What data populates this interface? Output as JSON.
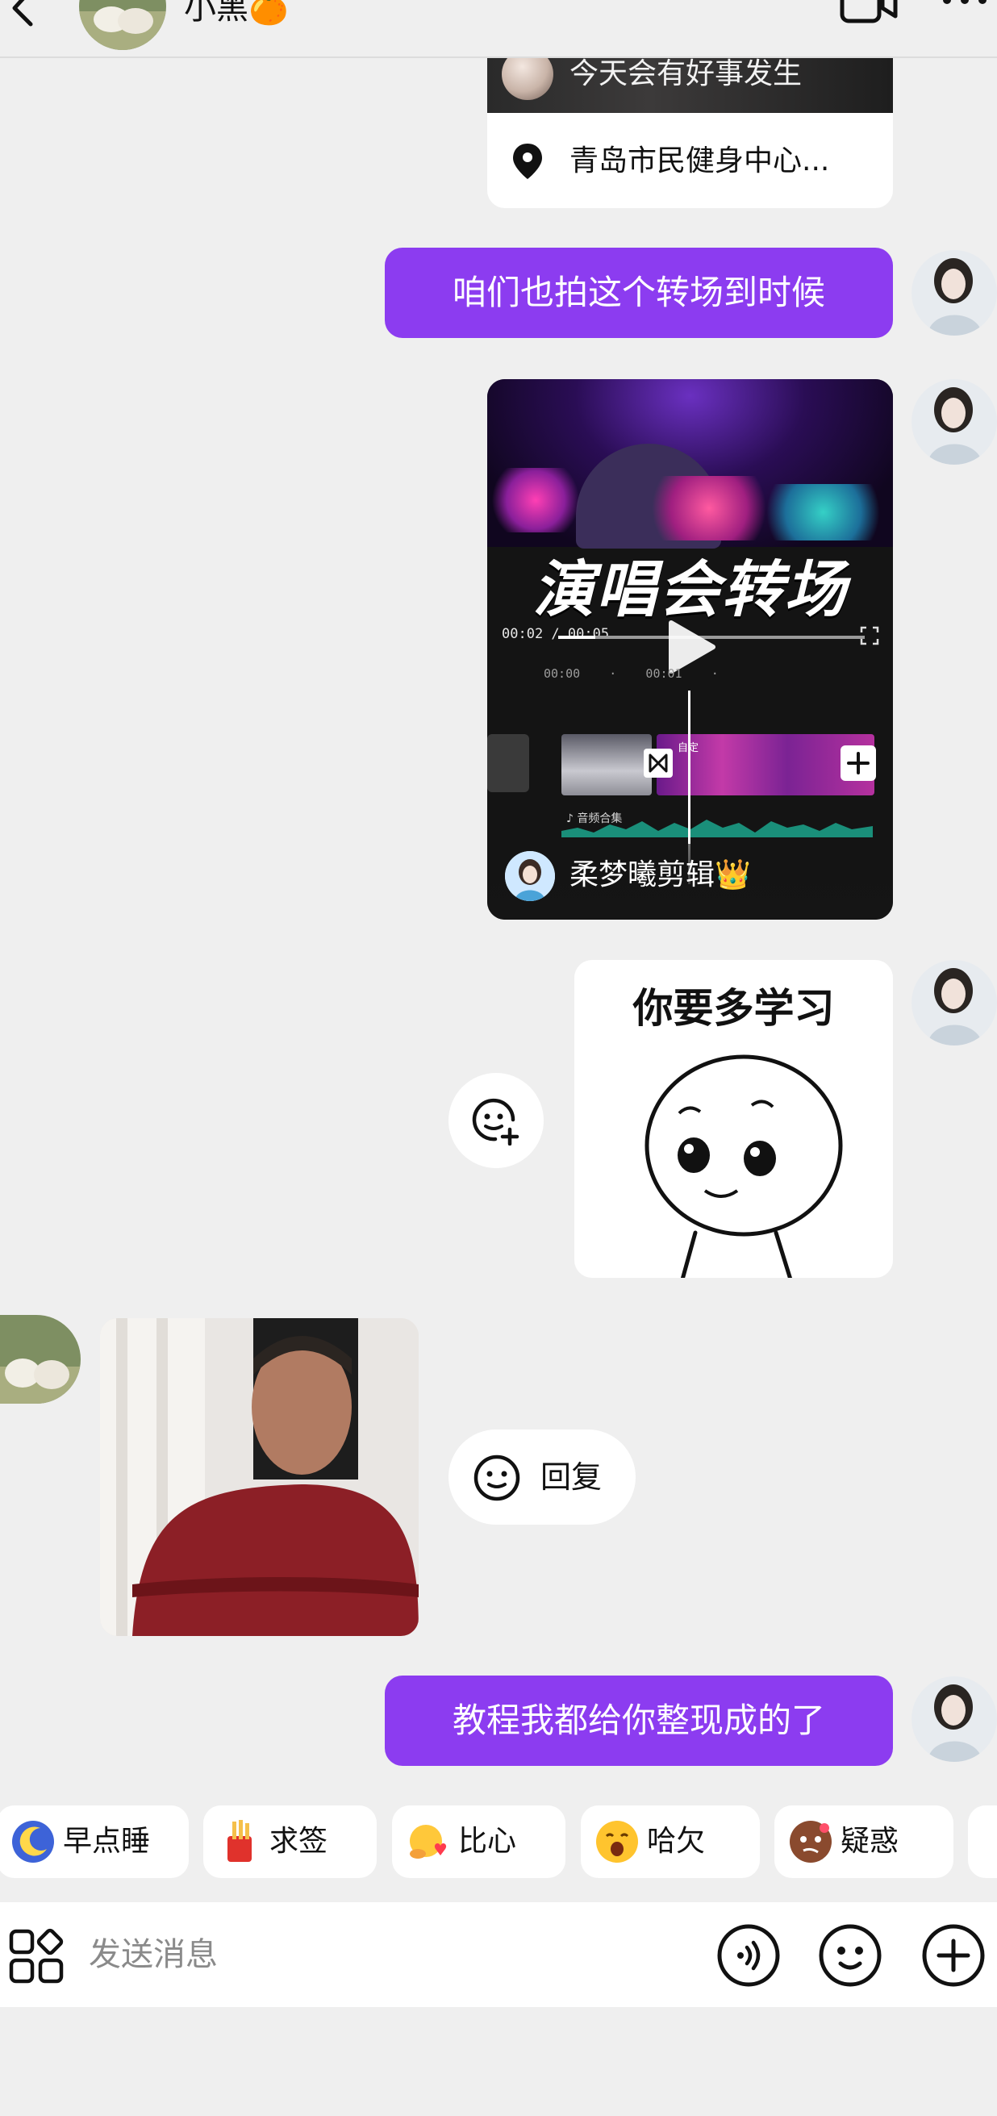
{
  "header": {
    "contact_name": "小黑🍊"
  },
  "messages": {
    "location_card": {
      "caption": "今天会有好事发生",
      "address": "青岛市民健身中心..."
    },
    "text_1": "咱们也拍这个转场到时候",
    "video_card": {
      "title": "演唱会转场",
      "time": "00:02 / 00:05",
      "timeline_ticks": "00:00    ·    00:01    ·",
      "clip_label": "自定",
      "audio_label": "♪ 音频合集",
      "author": "柔梦曦剪辑👑"
    },
    "sticker_text": "你要多学习",
    "reply_label": "回复",
    "text_2": "教程我都给你整现成的了"
  },
  "quick_emojis": [
    {
      "label": "早点睡",
      "icon": "sleep-moon-icon"
    },
    {
      "label": "求签",
      "icon": "fortune-stick-icon"
    },
    {
      "label": "比心",
      "icon": "heart-hand-icon"
    },
    {
      "label": "哈欠",
      "icon": "yawn-face-icon"
    },
    {
      "label": "疑惑",
      "icon": "confused-face-icon"
    }
  ],
  "input": {
    "placeholder": "发送消息"
  },
  "colors": {
    "bubble_me": "#8c3cf0",
    "background": "#efefef"
  }
}
